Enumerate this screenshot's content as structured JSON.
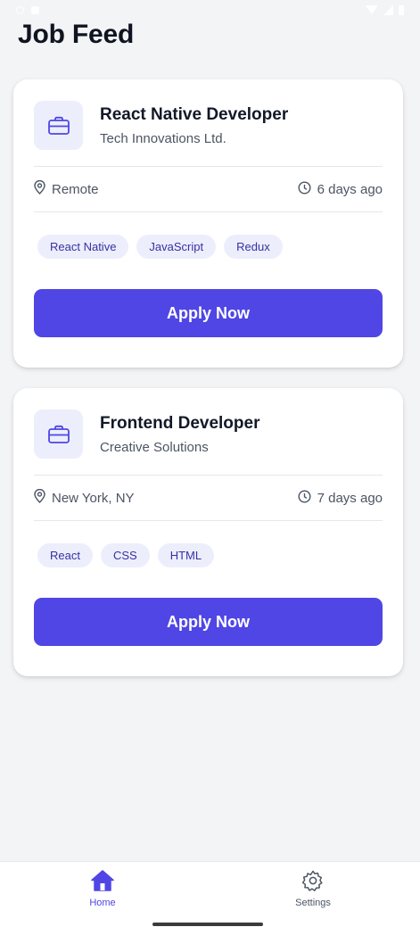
{
  "screen": {
    "title": "Job Feed"
  },
  "jobs": [
    {
      "title": "React Native Developer",
      "company": "Tech Innovations Ltd.",
      "location": "Remote",
      "posted": "6 days ago",
      "tags": [
        "React Native",
        "JavaScript",
        "Redux"
      ],
      "apply_label": "Apply Now"
    },
    {
      "title": "Frontend Developer",
      "company": "Creative Solutions",
      "location": "New York, NY",
      "posted": "7 days ago",
      "tags": [
        "React",
        "CSS",
        "HTML"
      ],
      "apply_label": "Apply Now"
    }
  ],
  "bottom_nav": {
    "items": [
      {
        "label": "Home",
        "icon": "home-icon",
        "active": true
      },
      {
        "label": "Settings",
        "icon": "gear-icon",
        "active": false
      }
    ]
  },
  "colors": {
    "accent": "#4f46e5",
    "tag_bg": "#eceefc",
    "tag_text": "#3730a3",
    "background": "#f3f4f6"
  }
}
